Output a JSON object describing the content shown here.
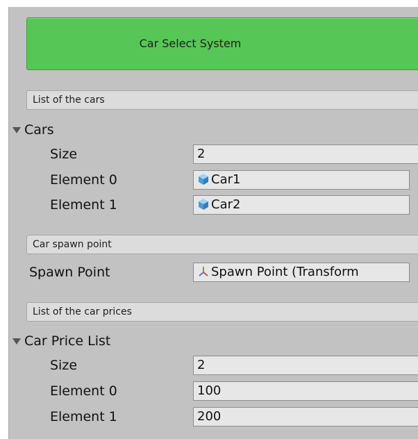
{
  "banner": {
    "title": "Car Select System"
  },
  "sections": {
    "cars_header": "List of the cars",
    "spawn_header": "Car spawn point",
    "prices_header": "List of the car prices"
  },
  "cars": {
    "label": "Cars",
    "size_label": "Size",
    "size_value": "2",
    "elements": [
      {
        "label": "Element 0",
        "value": "Car1",
        "icon": "cube-icon"
      },
      {
        "label": "Element 1",
        "value": "Car2",
        "icon": "cube-icon"
      }
    ]
  },
  "spawn": {
    "label": "Spawn Point",
    "value": "Spawn Point (Transform",
    "icon": "transform-icon"
  },
  "prices": {
    "label": "Car Price List",
    "size_label": "Size",
    "size_value": "2",
    "elements": [
      {
        "label": "Element 0",
        "value": "100"
      },
      {
        "label": "Element 1",
        "value": "200"
      }
    ]
  },
  "colors": {
    "banner": "#56c756",
    "panel": "#c2c2c2",
    "field": "#e7e7e7",
    "cube_icon": "#5aa8e6",
    "transform_icon": "#d84a3a"
  }
}
